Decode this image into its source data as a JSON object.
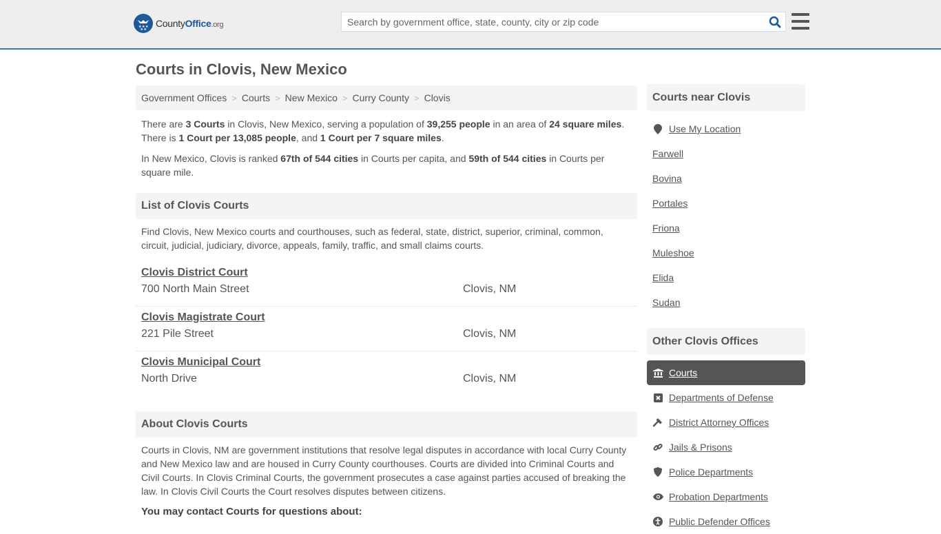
{
  "header": {
    "logo": {
      "brand_main": "County",
      "brand_accent": "Office",
      "brand_tld": ".org"
    },
    "search": {
      "placeholder": "Search by government office, state, county, city or zip code",
      "value": ""
    },
    "icons": {
      "search": "search-icon",
      "menu": "hamburger-menu-icon"
    }
  },
  "page": {
    "title": "Courts in Clovis, New Mexico"
  },
  "breadcrumb": [
    "Government Offices",
    "Courts",
    "New Mexico",
    "Curry County",
    "Clovis"
  ],
  "summary": {
    "p1": {
      "t1": "There are ",
      "b1": "3 Courts",
      "t2": " in Clovis, New Mexico, serving a population of ",
      "b2": "39,255 people",
      "t3": " in an area of ",
      "b3": "24 square miles",
      "t4": ". There is ",
      "b4": "1 Court per 13,085 people",
      "t5": ", and ",
      "b5": "1 Court per 7 square miles",
      "t6": "."
    },
    "p2": {
      "t1": "In New Mexico, Clovis is ranked ",
      "b1": "67th of 544 cities",
      "t2": " in Courts per capita, and ",
      "b2": "59th of 544 cities",
      "t3": " in Courts per square mile."
    }
  },
  "list_section": {
    "title": "List of Clovis Courts",
    "description": "Find Clovis, New Mexico courts and courthouses, such as federal, state, district, superior, criminal, common, circuit, judicial, judiciary, divorce, appeals, family, traffic, and small claims courts.",
    "courts": [
      {
        "name": "Clovis District Court",
        "address": "700 North Main Street",
        "city": "Clovis, NM"
      },
      {
        "name": "Clovis Magistrate Court",
        "address": "221 Pile Street",
        "city": "Clovis, NM"
      },
      {
        "name": "Clovis Municipal Court",
        "address": "North Drive",
        "city": "Clovis, NM"
      }
    ]
  },
  "about_section": {
    "title": "About Clovis Courts",
    "text": "Courts in Clovis, NM are government institutions that resolve legal disputes in accordance with local Curry County and New Mexico law and are housed in Curry County courthouses. Courts are divided into Criminal Courts and Civil Courts. In Clovis Criminal Courts, the government prosecutes a case against parties accused of breaking the law. In Clovis Civil Courts the Court resolves disputes between citizens.",
    "contact_heading": "You may contact Courts for questions about:"
  },
  "sidebar": {
    "nearby": {
      "title": "Courts near Clovis",
      "use_location": {
        "label": "Use My Location",
        "icon": "map-marker-icon"
      },
      "cities": [
        "Farwell",
        "Bovina",
        "Portales",
        "Friona",
        "Muleshoe",
        "Elida",
        "Sudan"
      ]
    },
    "other": {
      "title": "Other Clovis Offices",
      "items": [
        {
          "label": "Courts",
          "icon": "courthouse-icon",
          "active": true
        },
        {
          "label": "Departments of Defense",
          "icon": "close-box-icon",
          "active": false
        },
        {
          "label": "District Attorney Offices",
          "icon": "gavel-icon",
          "active": false
        },
        {
          "label": "Jails & Prisons",
          "icon": "chain-link-icon",
          "active": false
        },
        {
          "label": "Police Departments",
          "icon": "shield-icon",
          "active": false
        },
        {
          "label": "Probation Departments",
          "icon": "eye-icon",
          "active": false
        },
        {
          "label": "Public Defender Offices",
          "icon": "accessibility-icon",
          "active": false
        }
      ]
    }
  },
  "colors": {
    "accent": "#3a7cb0",
    "brand": "#1e5a9a",
    "text": "#555555",
    "panel": "#f4f4f4",
    "active_bg": "#555555"
  }
}
